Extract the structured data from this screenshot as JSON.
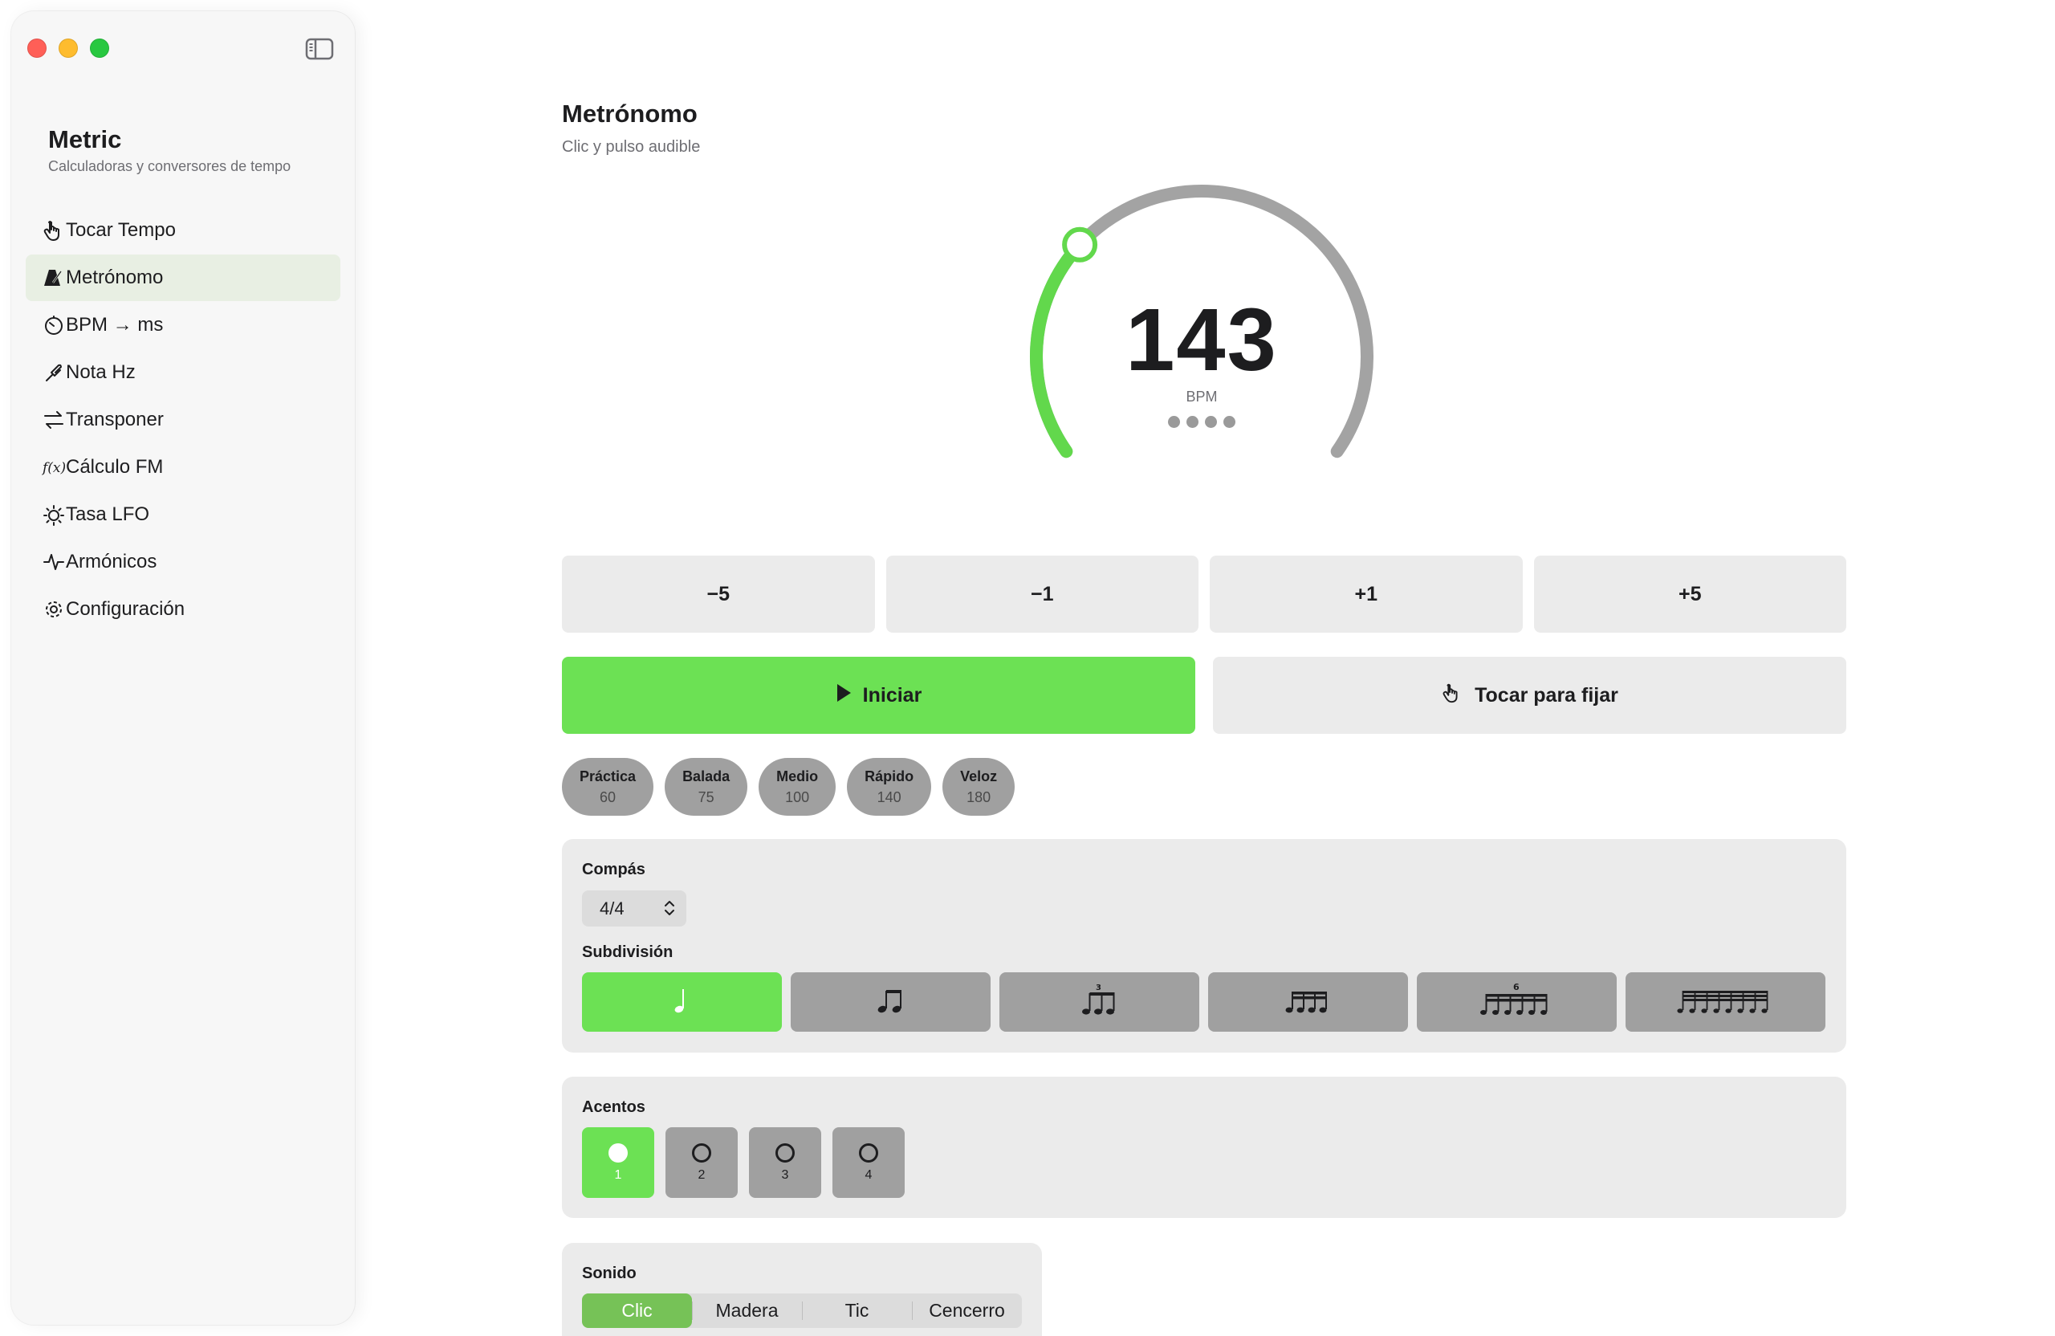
{
  "window": {
    "controls": [
      "close",
      "minimize",
      "zoom"
    ],
    "sidebar_toggle_icon": "sidebar-left-icon"
  },
  "sidebar": {
    "app_name": "Metric",
    "app_subtitle": "Calculadoras y conversores de tempo",
    "items": [
      {
        "label": "Tocar Tempo",
        "icon": "hand-tap-icon",
        "active": false
      },
      {
        "label": "Metrónomo",
        "icon": "metronome-icon",
        "active": true
      },
      {
        "label": "BPM → ms",
        "icon": "timer-icon",
        "active": false
      },
      {
        "label": "Nota Hz",
        "icon": "tuning-fork-icon",
        "active": false
      },
      {
        "label": "Transponer",
        "icon": "arrows-swap-icon",
        "active": false
      },
      {
        "label": "Cálculo FM",
        "icon": "function-icon",
        "active": false
      },
      {
        "label": "Tasa LFO",
        "icon": "sun-dial-icon",
        "active": false
      },
      {
        "label": "Armónicos",
        "icon": "waveform-icon",
        "active": false
      },
      {
        "label": "Configuración",
        "icon": "gear-icon",
        "active": false
      }
    ]
  },
  "main": {
    "title": "Metrónomo",
    "subtitle": "Clic y pulso audible",
    "dial": {
      "bpm": "143",
      "unit": "BPM",
      "beats_per_bar": 4,
      "fill_fraction": 0.31,
      "accent_color": "#62d84c",
      "track_color": "#a3a3a3"
    },
    "steps": [
      "−5",
      "−1",
      "+1",
      "+5"
    ],
    "start_label": "Iniciar",
    "tap_label": "Tocar para fijar",
    "presets": [
      {
        "name": "Práctica",
        "bpm": "60"
      },
      {
        "name": "Balada",
        "bpm": "75"
      },
      {
        "name": "Medio",
        "bpm": "100"
      },
      {
        "name": "Rápido",
        "bpm": "140"
      },
      {
        "name": "Veloz",
        "bpm": "180"
      }
    ],
    "compas": {
      "label": "Compás",
      "value": "4/4",
      "subdivision_label": "Subdivisión",
      "subdivisions": [
        {
          "name": "quarter-note",
          "active": true
        },
        {
          "name": "eighth-notes",
          "active": false
        },
        {
          "name": "triplets",
          "active": false,
          "tuplet": "3"
        },
        {
          "name": "sixteenth-notes",
          "active": false
        },
        {
          "name": "sextuplets",
          "active": false,
          "tuplet": "6"
        },
        {
          "name": "thirty-second-notes",
          "active": false
        }
      ]
    },
    "accents": {
      "label": "Acentos",
      "beats": [
        {
          "num": "1",
          "active": true
        },
        {
          "num": "2",
          "active": false
        },
        {
          "num": "3",
          "active": false
        },
        {
          "num": "4",
          "active": false
        }
      ]
    },
    "sound": {
      "label": "Sonido",
      "options": [
        "Clic",
        "Madera",
        "Tic",
        "Cencerro"
      ],
      "selected": "Clic"
    }
  }
}
